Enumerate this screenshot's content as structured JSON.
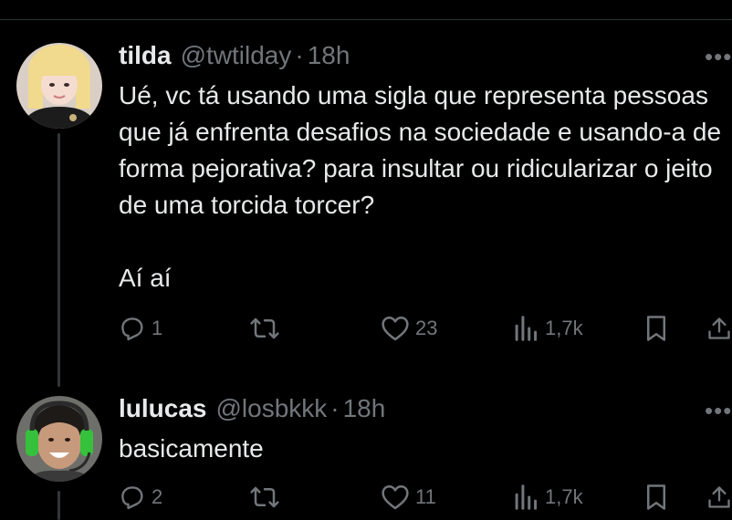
{
  "tweets": [
    {
      "name": "tilda",
      "handle": "@twtilday",
      "separator": "·",
      "time": "18h",
      "text": "Ué, vc tá usando uma sigla que representa pessoas que já enfrenta desafios na sociedade e usando-a de forma pejorativa? para insultar ou ridicularizar o jeito de uma torcida torcer?\n\nAí aí",
      "replies": "1",
      "likes": "23",
      "views": "1,7k",
      "more_icon": "ellipsis-icon"
    },
    {
      "name": "lulucas",
      "handle": "@losbkkk",
      "separator": "·",
      "time": "18h",
      "text": "basicamente",
      "replies": "2",
      "likes": "11",
      "views": "1,7k",
      "more_icon": "ellipsis-icon"
    }
  ],
  "colors": {
    "background": "#000000",
    "text": "#e7e9ea",
    "muted": "#71767b",
    "thread_line": "#333639"
  }
}
